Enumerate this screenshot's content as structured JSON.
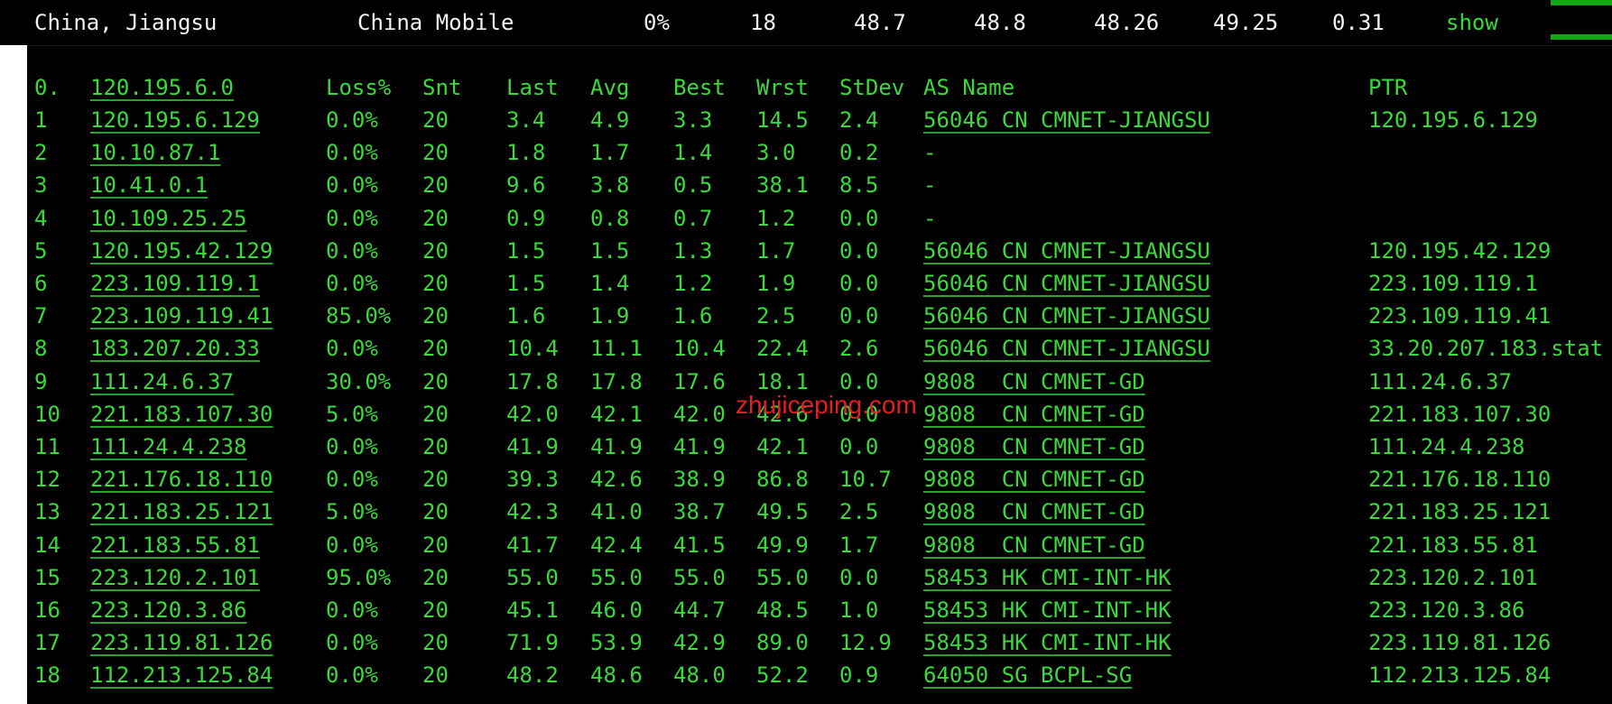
{
  "summary": {
    "location": "China, Jiangsu",
    "isp": "China Mobile",
    "loss": "0%",
    "hops": "18",
    "v1": "48.7",
    "v2": "48.8",
    "v3": "48.26",
    "v4": "49.25",
    "v5": "0.31",
    "show_label": "show"
  },
  "header": {
    "index": "0.",
    "host": "120.195.6.0",
    "loss": "Loss%",
    "snt": "Snt",
    "last": "Last",
    "avg": "Avg",
    "best": "Best",
    "wrst": "Wrst",
    "stdev": "StDev",
    "as_name": "AS Name",
    "ptr": "PTR"
  },
  "hops": [
    {
      "n": "1",
      "ip": "120.195.6.129",
      "loss": "0.0%",
      "snt": "20",
      "last": "3.4",
      "avg": "4.9",
      "best": "3.3",
      "wrst": "14.5",
      "stdev": "2.4",
      "as": "56046 CN CMNET-JIANGSU",
      "ptr": "120.195.6.129"
    },
    {
      "n": "2",
      "ip": "10.10.87.1",
      "loss": "0.0%",
      "snt": "20",
      "last": "1.8",
      "avg": "1.7",
      "best": "1.4",
      "wrst": "3.0",
      "stdev": "0.2",
      "as": "-",
      "ptr": ""
    },
    {
      "n": "3",
      "ip": "10.41.0.1",
      "loss": "0.0%",
      "snt": "20",
      "last": "9.6",
      "avg": "3.8",
      "best": "0.5",
      "wrst": "38.1",
      "stdev": "8.5",
      "as": "-",
      "ptr": ""
    },
    {
      "n": "4",
      "ip": "10.109.25.25",
      "loss": "0.0%",
      "snt": "20",
      "last": "0.9",
      "avg": "0.8",
      "best": "0.7",
      "wrst": "1.2",
      "stdev": "0.0",
      "as": "-",
      "ptr": ""
    },
    {
      "n": "5",
      "ip": "120.195.42.129",
      "loss": "0.0%",
      "snt": "20",
      "last": "1.5",
      "avg": "1.5",
      "best": "1.3",
      "wrst": "1.7",
      "stdev": "0.0",
      "as": "56046 CN CMNET-JIANGSU",
      "ptr": "120.195.42.129"
    },
    {
      "n": "6",
      "ip": "223.109.119.1",
      "loss": "0.0%",
      "snt": "20",
      "last": "1.5",
      "avg": "1.4",
      "best": "1.2",
      "wrst": "1.9",
      "stdev": "0.0",
      "as": "56046 CN CMNET-JIANGSU",
      "ptr": "223.109.119.1"
    },
    {
      "n": "7",
      "ip": "223.109.119.41",
      "loss": "85.0%",
      "snt": "20",
      "last": "1.6",
      "avg": "1.9",
      "best": "1.6",
      "wrst": "2.5",
      "stdev": "0.0",
      "as": "56046 CN CMNET-JIANGSU",
      "ptr": "223.109.119.41"
    },
    {
      "n": "8",
      "ip": "183.207.20.33",
      "loss": "0.0%",
      "snt": "20",
      "last": "10.4",
      "avg": "11.1",
      "best": "10.4",
      "wrst": "22.4",
      "stdev": "2.6",
      "as": "56046 CN CMNET-JIANGSU",
      "ptr": "33.20.207.183.stat"
    },
    {
      "n": "9",
      "ip": "111.24.6.37",
      "loss": "30.0%",
      "snt": "20",
      "last": "17.8",
      "avg": "17.8",
      "best": "17.6",
      "wrst": "18.1",
      "stdev": "0.0",
      "as": "9808  CN CMNET-GD",
      "ptr": "111.24.6.37"
    },
    {
      "n": "10",
      "ip": "221.183.107.30",
      "loss": "5.0%",
      "snt": "20",
      "last": "42.0",
      "avg": "42.1",
      "best": "42.0",
      "wrst": "42.6",
      "stdev": "0.0",
      "as": "9808  CN CMNET-GD",
      "ptr": "221.183.107.30"
    },
    {
      "n": "11",
      "ip": "111.24.4.238",
      "loss": "0.0%",
      "snt": "20",
      "last": "41.9",
      "avg": "41.9",
      "best": "41.9",
      "wrst": "42.1",
      "stdev": "0.0",
      "as": "9808  CN CMNET-GD",
      "ptr": "111.24.4.238"
    },
    {
      "n": "12",
      "ip": "221.176.18.110",
      "loss": "0.0%",
      "snt": "20",
      "last": "39.3",
      "avg": "42.6",
      "best": "38.9",
      "wrst": "86.8",
      "stdev": "10.7",
      "as": "9808  CN CMNET-GD",
      "ptr": "221.176.18.110"
    },
    {
      "n": "13",
      "ip": "221.183.25.121",
      "loss": "5.0%",
      "snt": "20",
      "last": "42.3",
      "avg": "41.0",
      "best": "38.7",
      "wrst": "49.5",
      "stdev": "2.5",
      "as": "9808  CN CMNET-GD",
      "ptr": "221.183.25.121"
    },
    {
      "n": "14",
      "ip": "221.183.55.81",
      "loss": "0.0%",
      "snt": "20",
      "last": "41.7",
      "avg": "42.4",
      "best": "41.5",
      "wrst": "49.9",
      "stdev": "1.7",
      "as": "9808  CN CMNET-GD",
      "ptr": "221.183.55.81"
    },
    {
      "n": "15",
      "ip": "223.120.2.101",
      "loss": "95.0%",
      "snt": "20",
      "last": "55.0",
      "avg": "55.0",
      "best": "55.0",
      "wrst": "55.0",
      "stdev": "0.0",
      "as": "58453 HK CMI-INT-HK",
      "ptr": "223.120.2.101"
    },
    {
      "n": "16",
      "ip": "223.120.3.86",
      "loss": "0.0%",
      "snt": "20",
      "last": "45.1",
      "avg": "46.0",
      "best": "44.7",
      "wrst": "48.5",
      "stdev": "1.0",
      "as": "58453 HK CMI-INT-HK",
      "ptr": "223.120.3.86"
    },
    {
      "n": "17",
      "ip": "223.119.81.126",
      "loss": "0.0%",
      "snt": "20",
      "last": "71.9",
      "avg": "53.9",
      "best": "42.9",
      "wrst": "89.0",
      "stdev": "12.9",
      "as": "58453 HK CMI-INT-HK",
      "ptr": "223.119.81.126"
    },
    {
      "n": "18",
      "ip": "112.213.125.84",
      "loss": "0.0%",
      "snt": "20",
      "last": "48.2",
      "avg": "48.6",
      "best": "48.0",
      "wrst": "52.2",
      "stdev": "0.9",
      "as": "64050 SG BCPL-SG",
      "ptr": "112.213.125.84"
    }
  ],
  "watermark": "zhujiceping.com",
  "colors": {
    "terminal_bg": "#000000",
    "text_green": "#3bd93b",
    "top_text": "#f2f2f2",
    "accent": "#14a714",
    "watermark": "#e32020"
  }
}
